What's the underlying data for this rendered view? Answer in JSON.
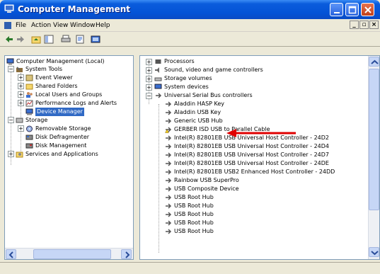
{
  "window": {
    "title": "Computer Management"
  },
  "menu": {
    "items": [
      "File",
      "Action",
      "View",
      "Window",
      "Help"
    ]
  },
  "tree": {
    "nodes": [
      "Computer Management (Local)",
      "System Tools",
      "Event Viewer",
      "Shared Folders",
      "Local Users and Groups",
      "Performance Logs and Alerts",
      "Device Manager",
      "Storage",
      "Removable Storage",
      "Disk Defragmenter",
      "Disk Management",
      "Services and Applications"
    ]
  },
  "devices": {
    "items": [
      "Processors",
      "Sound, video and game controllers",
      "Storage volumes",
      "System devices",
      "Universal Serial Bus controllers",
      "Aladdin HASP Key",
      "Aladdin USB Key",
      "Generic USB Hub",
      "GERBER ISD USB to Parallel Cable",
      "Intel(R) 82801EB USB Universal Host Controller - 24D2",
      "Intel(R) 82801EB USB Universal Host Controller - 24D4",
      "Intel(R) 82801EB USB Universal Host Controller - 24D7",
      "Intel(R) 82801EB USB Universal Host Controller - 24DE",
      "Intel(R) 82801EB USB2 Enhanced Host Controller - 24DD",
      "Rainbow USB SuperPro",
      "USB Composite Device",
      "USB Root Hub",
      "USB Root Hub",
      "USB Root Hub",
      "USB Root Hub",
      "USB Root Hub"
    ]
  },
  "colors": {
    "title_blue": "#0a5cdc",
    "selection": "#316ac5",
    "annotation_arrow": "#e00000"
  },
  "icons": {
    "window": "computer-management-icon",
    "warning": "warning-icon",
    "usb": "usb-plug-icon"
  }
}
